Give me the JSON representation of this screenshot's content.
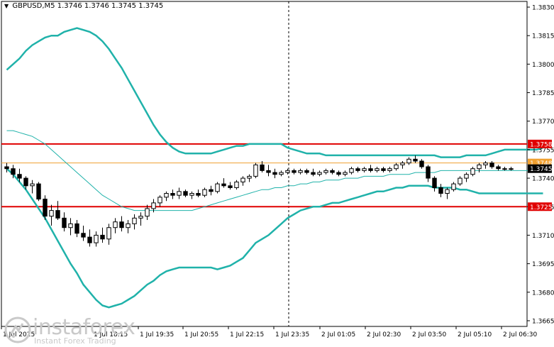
{
  "title": {
    "symbol": "GBPUSD,M5",
    "ohlc": "1.3746 1.3746 1.3745 1.3745"
  },
  "watermark": {
    "brand": "instaforex",
    "tagline": "Instant Forex Trading",
    "icon": "instaforex-logo-icon"
  },
  "colors": {
    "bands": "#20b2aa",
    "sma": "#20b2aa",
    "resistance": "#e00000",
    "support": "#e00000",
    "current_line": "#f0a030",
    "candle": "#000000"
  },
  "chart_data": {
    "type": "candlestick",
    "ylim": [
      1.3662,
      1.3833
    ],
    "y_ticks": [
      "1.3830",
      "1.3815",
      "1.3800",
      "1.3785",
      "1.3770",
      "1.3755",
      "1.3740",
      "1.3725",
      "1.3710",
      "1.3695",
      "1.3680",
      "1.3665"
    ],
    "x_ticks": [
      "1 Jul 2025",
      "1 Jul 18:15",
      "1 Jul 19:35",
      "1 Jul 20:55",
      "1 Jul 22:15",
      "1 Jul 23:35",
      "2 Jul 01:05",
      "2 Jul 02:30",
      "2 Jul 03:50",
      "2 Jul 05:10",
      "2 Jul 06:30"
    ],
    "levels": [
      {
        "name": "resistance",
        "value": 1.3758,
        "label": "1.3758"
      },
      {
        "name": "support",
        "value": 1.3725,
        "label": "1.3725"
      }
    ],
    "price_labels": [
      {
        "name": "level-1",
        "value": 1.3748,
        "label": "1.3748"
      },
      {
        "name": "current",
        "value": 1.3745,
        "label": "1.3745"
      }
    ],
    "separator_label": "1 Jul 23:35",
    "upper_band": [
      1.3797,
      1.38,
      1.3803,
      1.3807,
      1.381,
      1.3812,
      1.3814,
      1.3815,
      1.3815,
      1.3817,
      1.3818,
      1.3819,
      1.3818,
      1.3817,
      1.3815,
      1.3812,
      1.3808,
      1.3803,
      1.3798,
      1.3792,
      1.3786,
      1.378,
      1.3774,
      1.3768,
      1.3763,
      1.3759,
      1.3756,
      1.3754,
      1.3753,
      1.3753,
      1.3753,
      1.3753,
      1.3753,
      1.3754,
      1.3755,
      1.3756,
      1.3757,
      1.3757,
      1.3758,
      1.3758,
      1.3758,
      1.3758,
      1.3758,
      1.3758,
      1.3756,
      1.3755,
      1.3754,
      1.3753,
      1.3753,
      1.3753,
      1.3752,
      1.3752,
      1.3752,
      1.3752,
      1.3752,
      1.3752,
      1.3752,
      1.3752,
      1.3752,
      1.3752,
      1.3752,
      1.3752,
      1.3752,
      1.3752,
      1.3752,
      1.3752,
      1.3752,
      1.3752,
      1.3751,
      1.3751,
      1.3751,
      1.3751,
      1.3752,
      1.3752,
      1.3752,
      1.3752,
      1.3753,
      1.3754,
      1.3755,
      1.3755,
      1.3755,
      1.3755,
      1.3755,
      1.3755,
      1.3756
    ],
    "middle_band": [
      1.3765,
      1.3765,
      1.3764,
      1.3763,
      1.3762,
      1.376,
      1.3758,
      1.3755,
      1.3752,
      1.3749,
      1.3746,
      1.3743,
      1.374,
      1.3737,
      1.3734,
      1.3731,
      1.3729,
      1.3727,
      1.3725,
      1.3724,
      1.3723,
      1.3723,
      1.3723,
      1.3723,
      1.3723,
      1.3723,
      1.3723,
      1.3723,
      1.3723,
      1.3723,
      1.3724,
      1.3725,
      1.3726,
      1.3727,
      1.3728,
      1.3729,
      1.373,
      1.3731,
      1.3732,
      1.3733,
      1.3734,
      1.3734,
      1.3735,
      1.3735,
      1.3736,
      1.3736,
      1.3737,
      1.3737,
      1.3738,
      1.3738,
      1.3739,
      1.3739,
      1.3739,
      1.374,
      1.374,
      1.374,
      1.3741,
      1.3741,
      1.3741,
      1.3741,
      1.3742,
      1.3742,
      1.3742,
      1.3742,
      1.3743,
      1.3743,
      1.3743,
      1.3743,
      1.3744,
      1.3744,
      1.3744,
      1.3744,
      1.3744,
      1.3744,
      1.3744,
      1.3744,
      1.3744,
      1.3744,
      1.3744,
      1.3744,
      1.3744,
      1.3744,
      1.3744,
      1.3744,
      1.3744
    ],
    "lower_band": [
      1.3745,
      1.3742,
      1.3738,
      1.3734,
      1.3729,
      1.3724,
      1.3719,
      1.3713,
      1.3707,
      1.3701,
      1.3695,
      1.369,
      1.3684,
      1.368,
      1.3676,
      1.3673,
      1.3672,
      1.3673,
      1.3674,
      1.3676,
      1.3678,
      1.3681,
      1.3684,
      1.3686,
      1.3689,
      1.3691,
      1.3692,
      1.3693,
      1.3693,
      1.3693,
      1.3693,
      1.3693,
      1.3693,
      1.3692,
      1.3693,
      1.3694,
      1.3696,
      1.3698,
      1.3702,
      1.3706,
      1.3708,
      1.371,
      1.3713,
      1.3716,
      1.3719,
      1.3721,
      1.3723,
      1.3724,
      1.3725,
      1.3725,
      1.3726,
      1.3727,
      1.3727,
      1.3728,
      1.3729,
      1.373,
      1.3731,
      1.3732,
      1.3733,
      1.3733,
      1.3734,
      1.3735,
      1.3735,
      1.3736,
      1.3736,
      1.3736,
      1.3736,
      1.3735,
      1.3735,
      1.3735,
      1.3735,
      1.3734,
      1.3734,
      1.3733,
      1.3732,
      1.3732,
      1.3732,
      1.3732,
      1.3732,
      1.3732,
      1.3732,
      1.3732,
      1.3732,
      1.3732,
      1.3732
    ],
    "candles": [
      [
        1.3746,
        1.3748,
        1.3743,
        1.3745
      ],
      [
        1.3745,
        1.3747,
        1.374,
        1.3742
      ],
      [
        1.3742,
        1.3745,
        1.3738,
        1.374
      ],
      [
        1.374,
        1.3741,
        1.3734,
        1.3736
      ],
      [
        1.3736,
        1.3739,
        1.3732,
        1.3737
      ],
      [
        1.3737,
        1.3738,
        1.3728,
        1.3729
      ],
      [
        1.3729,
        1.3731,
        1.3718,
        1.372
      ],
      [
        1.372,
        1.3726,
        1.3715,
        1.3723
      ],
      [
        1.3723,
        1.3728,
        1.3718,
        1.3719
      ],
      [
        1.3719,
        1.3722,
        1.3712,
        1.3714
      ],
      [
        1.3714,
        1.3719,
        1.371,
        1.3716
      ],
      [
        1.3716,
        1.3718,
        1.3709,
        1.3711
      ],
      [
        1.3711,
        1.3715,
        1.3707,
        1.3709
      ],
      [
        1.3709,
        1.3713,
        1.3704,
        1.3706
      ],
      [
        1.3706,
        1.3712,
        1.3704,
        1.371
      ],
      [
        1.371,
        1.3714,
        1.3706,
        1.3708
      ],
      [
        1.3708,
        1.3716,
        1.3705,
        1.3714
      ],
      [
        1.3714,
        1.3719,
        1.3711,
        1.3717
      ],
      [
        1.3717,
        1.372,
        1.3712,
        1.3714
      ],
      [
        1.3714,
        1.3718,
        1.3711,
        1.3716
      ],
      [
        1.3716,
        1.3721,
        1.3713,
        1.3719
      ],
      [
        1.3719,
        1.3722,
        1.3715,
        1.372
      ],
      [
        1.372,
        1.3726,
        1.3718,
        1.3724
      ],
      [
        1.3724,
        1.3729,
        1.3722,
        1.3727
      ],
      [
        1.3727,
        1.3731,
        1.3725,
        1.373
      ],
      [
        1.373,
        1.3733,
        1.3728,
        1.3732
      ],
      [
        1.3732,
        1.3734,
        1.3729,
        1.3731
      ],
      [
        1.3731,
        1.3735,
        1.3729,
        1.3733
      ],
      [
        1.3733,
        1.3734,
        1.373,
        1.3731
      ],
      [
        1.3731,
        1.3733,
        1.3729,
        1.3732
      ],
      [
        1.3732,
        1.3734,
        1.373,
        1.3731
      ],
      [
        1.3731,
        1.3735,
        1.373,
        1.3734
      ],
      [
        1.3734,
        1.3736,
        1.3731,
        1.3733
      ],
      [
        1.3733,
        1.3738,
        1.3732,
        1.3737
      ],
      [
        1.3737,
        1.374,
        1.3735,
        1.3736
      ],
      [
        1.3736,
        1.3738,
        1.3734,
        1.3735
      ],
      [
        1.3735,
        1.3739,
        1.3734,
        1.3738
      ],
      [
        1.3738,
        1.3741,
        1.3736,
        1.374
      ],
      [
        1.374,
        1.3742,
        1.3738,
        1.3741
      ],
      [
        1.3741,
        1.3748,
        1.374,
        1.3747
      ],
      [
        1.3747,
        1.3749,
        1.3743,
        1.3744
      ],
      [
        1.3744,
        1.3747,
        1.3741,
        1.3743
      ],
      [
        1.3743,
        1.3745,
        1.374,
        1.3742
      ],
      [
        1.3742,
        1.3744,
        1.3741,
        1.3743
      ],
      [
        1.3743,
        1.3745,
        1.3742,
        1.3744
      ],
      [
        1.3744,
        1.3745,
        1.3742,
        1.3743
      ],
      [
        1.3743,
        1.3745,
        1.3742,
        1.3744
      ],
      [
        1.3744,
        1.3745,
        1.3742,
        1.3743
      ],
      [
        1.3743,
        1.3745,
        1.3741,
        1.3742
      ],
      [
        1.3742,
        1.3744,
        1.3741,
        1.3743
      ],
      [
        1.3743,
        1.3745,
        1.3742,
        1.3744
      ],
      [
        1.3744,
        1.3745,
        1.3742,
        1.3743
      ],
      [
        1.3743,
        1.3744,
        1.3741,
        1.3742
      ],
      [
        1.3742,
        1.3744,
        1.3741,
        1.3743
      ],
      [
        1.3743,
        1.3746,
        1.3742,
        1.3745
      ],
      [
        1.3745,
        1.3746,
        1.3743,
        1.3744
      ],
      [
        1.3744,
        1.3746,
        1.3743,
        1.3745
      ],
      [
        1.3745,
        1.3747,
        1.3743,
        1.3744
      ],
      [
        1.3744,
        1.3746,
        1.3743,
        1.3745
      ],
      [
        1.3745,
        1.3746,
        1.3743,
        1.3744
      ],
      [
        1.3744,
        1.3746,
        1.3743,
        1.3745
      ],
      [
        1.3745,
        1.3748,
        1.3744,
        1.3747
      ],
      [
        1.3747,
        1.3749,
        1.3745,
        1.3748
      ],
      [
        1.3748,
        1.3751,
        1.3747,
        1.375
      ],
      [
        1.375,
        1.3752,
        1.3748,
        1.3749
      ],
      [
        1.3749,
        1.375,
        1.3745,
        1.3746
      ],
      [
        1.3746,
        1.3747,
        1.3738,
        1.374
      ],
      [
        1.374,
        1.3741,
        1.3733,
        1.3735
      ],
      [
        1.3735,
        1.3737,
        1.373,
        1.3732
      ],
      [
        1.3732,
        1.3735,
        1.3729,
        1.3734
      ],
      [
        1.3734,
        1.3738,
        1.3733,
        1.3737
      ],
      [
        1.3737,
        1.3741,
        1.3736,
        1.374
      ],
      [
        1.374,
        1.3743,
        1.3738,
        1.3742
      ],
      [
        1.3742,
        1.3746,
        1.3741,
        1.3745
      ],
      [
        1.3745,
        1.3748,
        1.3743,
        1.3747
      ],
      [
        1.3747,
        1.3749,
        1.3745,
        1.3748
      ],
      [
        1.3748,
        1.3749,
        1.3745,
        1.3746
      ],
      [
        1.3746,
        1.3747,
        1.3744,
        1.3745
      ],
      [
        1.3745,
        1.3746,
        1.3744,
        1.3745
      ],
      [
        1.3745,
        1.3746,
        1.3744,
        1.3745
      ]
    ]
  }
}
